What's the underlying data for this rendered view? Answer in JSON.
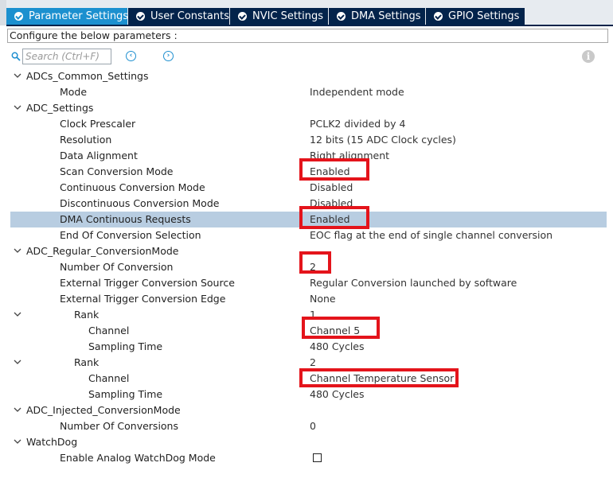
{
  "tabs": [
    {
      "label": "Parameter Settings",
      "active": true
    },
    {
      "label": "User Constants",
      "active": false
    },
    {
      "label": "NVIC Settings",
      "active": false
    },
    {
      "label": "DMA Settings",
      "active": false
    },
    {
      "label": "GPIO Settings",
      "active": false
    }
  ],
  "config_prompt": "Configure the below parameters :",
  "search": {
    "placeholder": "Search (Ctrl+F)"
  },
  "icons": {
    "search": "magnifier-icon",
    "prev": "circle-left-arrow-icon",
    "next": "circle-right-arrow-icon",
    "info": "info-icon",
    "expander": "chevron-down-icon"
  },
  "colors": {
    "tab_active": "#1c90cf",
    "tab_inactive": "#03234b",
    "selected_row": "#b8cde1",
    "highlight_box": "#e4141b"
  },
  "tree": [
    {
      "label": "ADCs_Common_Settings",
      "value": "",
      "group": true
    },
    {
      "label": "Mode",
      "value": "Independent mode"
    },
    {
      "label": "ADC_Settings",
      "value": "",
      "group": true
    },
    {
      "label": "Clock Prescaler",
      "value": "PCLK2 divided by 4"
    },
    {
      "label": "Resolution",
      "value": "12 bits (15 ADC Clock cycles)"
    },
    {
      "label": "Data Alignment",
      "value": "Right alignment"
    },
    {
      "label": "Scan Conversion Mode",
      "value": "Enabled"
    },
    {
      "label": "Continuous Conversion Mode",
      "value": "Disabled"
    },
    {
      "label": "Discontinuous Conversion Mode",
      "value": "Disabled"
    },
    {
      "label": "DMA Continuous Requests",
      "value": "Enabled",
      "selected": true
    },
    {
      "label": "End Of Conversion Selection",
      "value": "EOC flag at the end of single channel conversion"
    },
    {
      "label": "ADC_Regular_ConversionMode",
      "value": "",
      "group": true
    },
    {
      "label": "Number Of Conversion",
      "value": "2"
    },
    {
      "label": "External Trigger Conversion Source",
      "value": "Regular Conversion launched by software"
    },
    {
      "label": "External Trigger Conversion Edge",
      "value": "None"
    },
    {
      "label": "Rank",
      "value": "1",
      "group": true
    },
    {
      "label": "Channel",
      "value": "Channel 5"
    },
    {
      "label": "Sampling Time",
      "value": "480 Cycles"
    },
    {
      "label": "Rank",
      "value": "2",
      "group": true
    },
    {
      "label": "Channel",
      "value": "Channel Temperature Sensor"
    },
    {
      "label": "Sampling Time",
      "value": "480 Cycles"
    },
    {
      "label": "ADC_Injected_ConversionMode",
      "value": "",
      "group": true
    },
    {
      "label": "Number Of Conversions",
      "value": "0"
    },
    {
      "label": "WatchDog",
      "value": "",
      "group": true
    },
    {
      "label": "Enable Analog WatchDog Mode",
      "value": "",
      "checkbox": true,
      "checked": false
    }
  ]
}
